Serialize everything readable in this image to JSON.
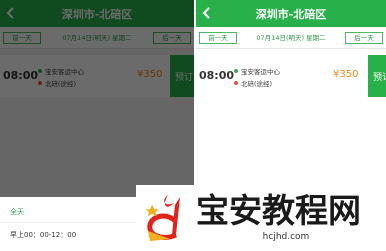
{
  "header": {
    "title": "深圳市-北碚区"
  },
  "datebar": {
    "prev": "前一天",
    "current": "07月14日(明天) 星期二",
    "next": "后一天"
  },
  "trip": {
    "time": "08:00",
    "from": "宝安客运中心",
    "to": "北碚(途经)",
    "price": "¥350",
    "book": "预订"
  },
  "sheet": {
    "all": "全天",
    "morning": "早上00：00-12：00"
  },
  "watermark": {
    "title": "宝安教程网",
    "url": "hcjhd.com"
  },
  "colors": {
    "brand_green": "#28b04a",
    "price_orange": "#f08a1c",
    "logo_red": "#e0241b"
  }
}
